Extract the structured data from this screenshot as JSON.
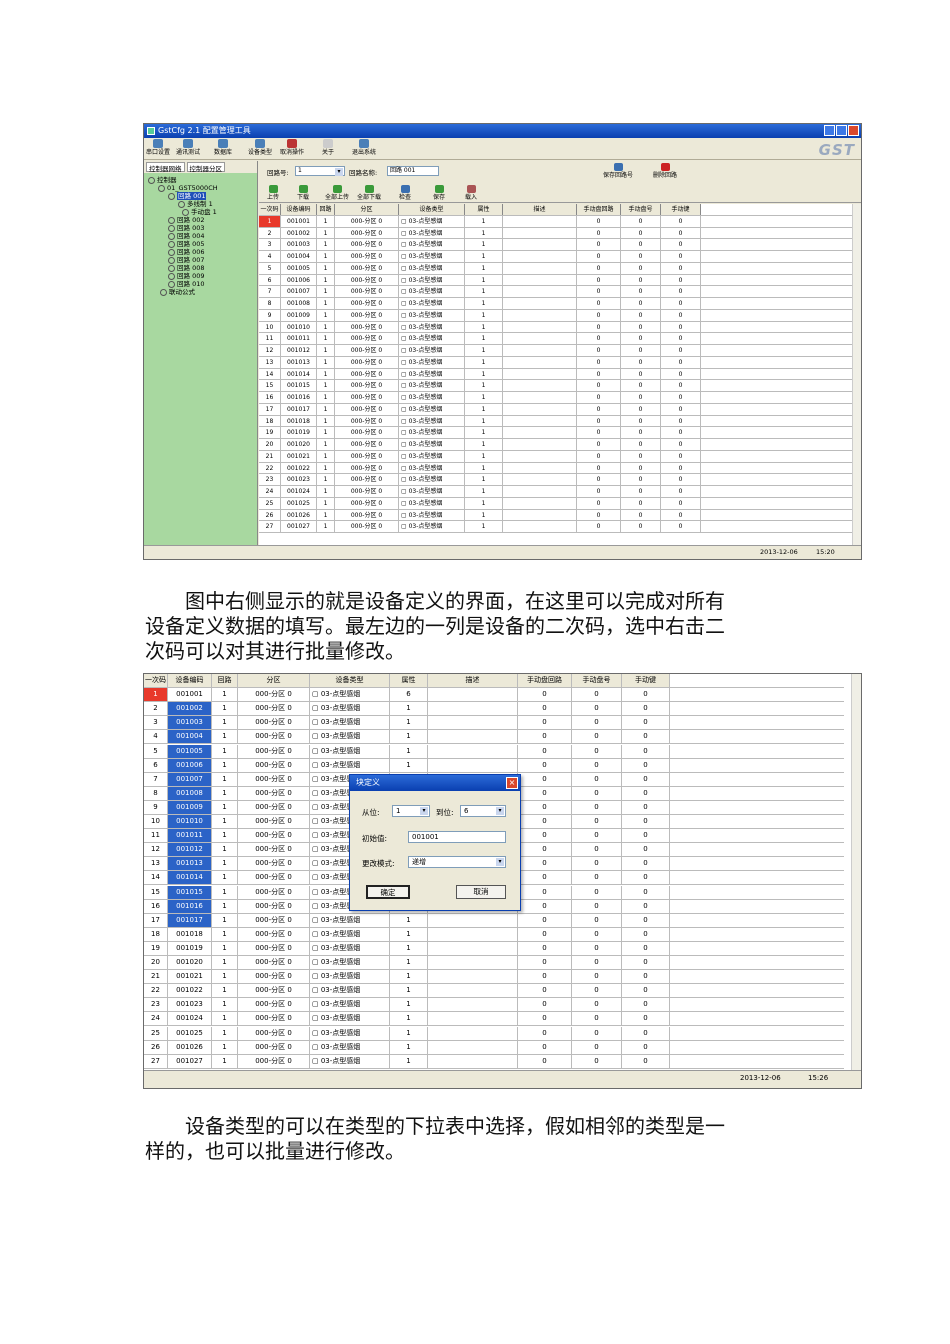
{
  "app": {
    "title": "GstCfg 2.1  配置管理工具",
    "logo": "GST",
    "toolbar": [
      "串口设置",
      "通讯测试",
      "数据库",
      "设备类型",
      "取消操作",
      "关于",
      "退出系统"
    ]
  },
  "tree": {
    "tabs": [
      "控制器网络",
      "控制器分区"
    ],
    "nodes": [
      "控制器",
      "01_GST5000CH",
      "回路 001",
      "多线制 1",
      "手动盘 1",
      "回路 002",
      "回路 003",
      "回路 004",
      "回路 005",
      "回路 006",
      "回路 007",
      "回路 008",
      "回路 009",
      "回路 010",
      "联动公式"
    ]
  },
  "loop_bar": {
    "loop_no_label": "回路号:",
    "loop_no_value": "1",
    "loop_name_label": "回路名称:",
    "loop_name_value": "回路 001",
    "save_loop_button": "保存回路号",
    "delete_loop_button": "删除回路",
    "actions": [
      "上传",
      "下载",
      "全部上传",
      "全部下载",
      "检查",
      "保存",
      "载入"
    ]
  },
  "grid": {
    "columns": [
      "一次码",
      "设备编码",
      "回路",
      "分区",
      "设备类型",
      "属性",
      "描述",
      "手动盘回路",
      "手动盘号",
      "手动键"
    ],
    "rows": [
      [
        "1",
        "001001",
        "1",
        "000-分区 0",
        "03-点型感烟",
        "1",
        "",
        "0",
        "0",
        "0"
      ],
      [
        "2",
        "001002",
        "1",
        "000-分区 0",
        "03-点型感烟",
        "1",
        "",
        "0",
        "0",
        "0"
      ],
      [
        "3",
        "001003",
        "1",
        "000-分区 0",
        "03-点型感烟",
        "1",
        "",
        "0",
        "0",
        "0"
      ],
      [
        "4",
        "001004",
        "1",
        "000-分区 0",
        "03-点型感烟",
        "1",
        "",
        "0",
        "0",
        "0"
      ],
      [
        "5",
        "001005",
        "1",
        "000-分区 0",
        "03-点型感烟",
        "1",
        "",
        "0",
        "0",
        "0"
      ],
      [
        "6",
        "001006",
        "1",
        "000-分区 0",
        "03-点型感烟",
        "1",
        "",
        "0",
        "0",
        "0"
      ],
      [
        "7",
        "001007",
        "1",
        "000-分区 0",
        "03-点型感烟",
        "1",
        "",
        "0",
        "0",
        "0"
      ],
      [
        "8",
        "001008",
        "1",
        "000-分区 0",
        "03-点型感烟",
        "1",
        "",
        "0",
        "0",
        "0"
      ],
      [
        "9",
        "001009",
        "1",
        "000-分区 0",
        "03-点型感烟",
        "1",
        "",
        "0",
        "0",
        "0"
      ],
      [
        "10",
        "001010",
        "1",
        "000-分区 0",
        "03-点型感烟",
        "1",
        "",
        "0",
        "0",
        "0"
      ],
      [
        "11",
        "001011",
        "1",
        "000-分区 0",
        "03-点型感烟",
        "1",
        "",
        "0",
        "0",
        "0"
      ],
      [
        "12",
        "001012",
        "1",
        "000-分区 0",
        "03-点型感烟",
        "1",
        "",
        "0",
        "0",
        "0"
      ],
      [
        "13",
        "001013",
        "1",
        "000-分区 0",
        "03-点型感烟",
        "1",
        "",
        "0",
        "0",
        "0"
      ],
      [
        "14",
        "001014",
        "1",
        "000-分区 0",
        "03-点型感烟",
        "1",
        "",
        "0",
        "0",
        "0"
      ],
      [
        "15",
        "001015",
        "1",
        "000-分区 0",
        "03-点型感烟",
        "1",
        "",
        "0",
        "0",
        "0"
      ],
      [
        "16",
        "001016",
        "1",
        "000-分区 0",
        "03-点型感烟",
        "1",
        "",
        "0",
        "0",
        "0"
      ],
      [
        "17",
        "001017",
        "1",
        "000-分区 0",
        "03-点型感烟",
        "1",
        "",
        "0",
        "0",
        "0"
      ],
      [
        "18",
        "001018",
        "1",
        "000-分区 0",
        "03-点型感烟",
        "1",
        "",
        "0",
        "0",
        "0"
      ],
      [
        "19",
        "001019",
        "1",
        "000-分区 0",
        "03-点型感烟",
        "1",
        "",
        "0",
        "0",
        "0"
      ],
      [
        "20",
        "001020",
        "1",
        "000-分区 0",
        "03-点型感烟",
        "1",
        "",
        "0",
        "0",
        "0"
      ],
      [
        "21",
        "001021",
        "1",
        "000-分区 0",
        "03-点型感烟",
        "1",
        "",
        "0",
        "0",
        "0"
      ],
      [
        "22",
        "001022",
        "1",
        "000-分区 0",
        "03-点型感烟",
        "1",
        "",
        "0",
        "0",
        "0"
      ],
      [
        "23",
        "001023",
        "1",
        "000-分区 0",
        "03-点型感烟",
        "1",
        "",
        "0",
        "0",
        "0"
      ],
      [
        "24",
        "001024",
        "1",
        "000-分区 0",
        "03-点型感烟",
        "1",
        "",
        "0",
        "0",
        "0"
      ],
      [
        "25",
        "001025",
        "1",
        "000-分区 0",
        "03-点型感烟",
        "1",
        "",
        "0",
        "0",
        "0"
      ],
      [
        "26",
        "001026",
        "1",
        "000-分区 0",
        "03-点型感烟",
        "1",
        "",
        "0",
        "0",
        "0"
      ],
      [
        "27",
        "001027",
        "1",
        "000-分区 0",
        "03-点型感烟",
        "1",
        "",
        "0",
        "0",
        "0"
      ]
    ],
    "shot2_first_row_attr": "6"
  },
  "status1": {
    "date": "2013-12-06",
    "time": "15:20"
  },
  "status2": {
    "date": "2013-12-06",
    "time": "15:26"
  },
  "dialog": {
    "title": "块定义",
    "from_label": "从位:",
    "from_value": "1",
    "to_label": "到位:",
    "to_value": "6",
    "init_label": "初始值:",
    "init_value": "001001",
    "mode_label": "更改模式:",
    "mode_value": "递增",
    "ok": "确定",
    "cancel": "取消"
  },
  "text": {
    "para1": [
      "图中右侧显示的就是设备定义的界面，在这里可以完成对所有",
      "设备定义数据的填写。最左边的一列是设备的二次码，选中右击二",
      "次码可以对其进行批量修改。"
    ],
    "para2": [
      "设备类型的可以在类型的下拉表中选择，假如相邻的类型是一",
      "样的，也可以批量进行修改。"
    ]
  },
  "colors": {
    "title_bar": "#0a3fb0",
    "tree_bg": "#a8d8a0",
    "selected_red": "#e8392b",
    "selected_blue": "#2b63c7"
  }
}
